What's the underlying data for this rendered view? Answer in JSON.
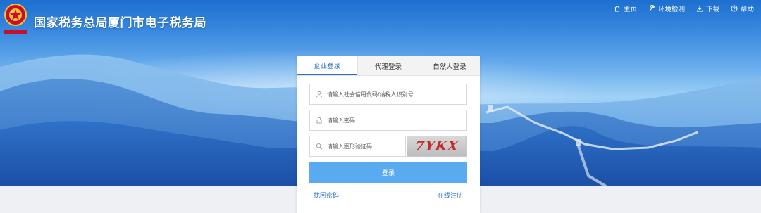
{
  "header": {
    "title": "国家税务总局厦门市电子税务局",
    "logo_icon": "tax-emblem-icon",
    "nav": [
      {
        "label": "主页",
        "icon": "home-icon"
      },
      {
        "label": "环境检测",
        "icon": "wrench-icon"
      },
      {
        "label": "下载",
        "icon": "download-icon"
      },
      {
        "label": "帮助",
        "icon": "help-icon"
      }
    ]
  },
  "login": {
    "tabs": [
      {
        "label": "企业登录",
        "active": true
      },
      {
        "label": "代理登录",
        "active": false
      },
      {
        "label": "自然人登录",
        "active": false
      }
    ],
    "account_placeholder": "请输入社会信用代码/纳税人识别号",
    "password_placeholder": "请输入密码",
    "captcha_placeholder": "请输入图形验证码",
    "captcha_text": "7YKX",
    "login_button": "登录",
    "forgot_password": "找回密码",
    "register": "在线注册"
  },
  "colors": {
    "accent": "#2a6fc9",
    "button": "#5aaaf0",
    "captcha_text": "#c42b2b"
  }
}
